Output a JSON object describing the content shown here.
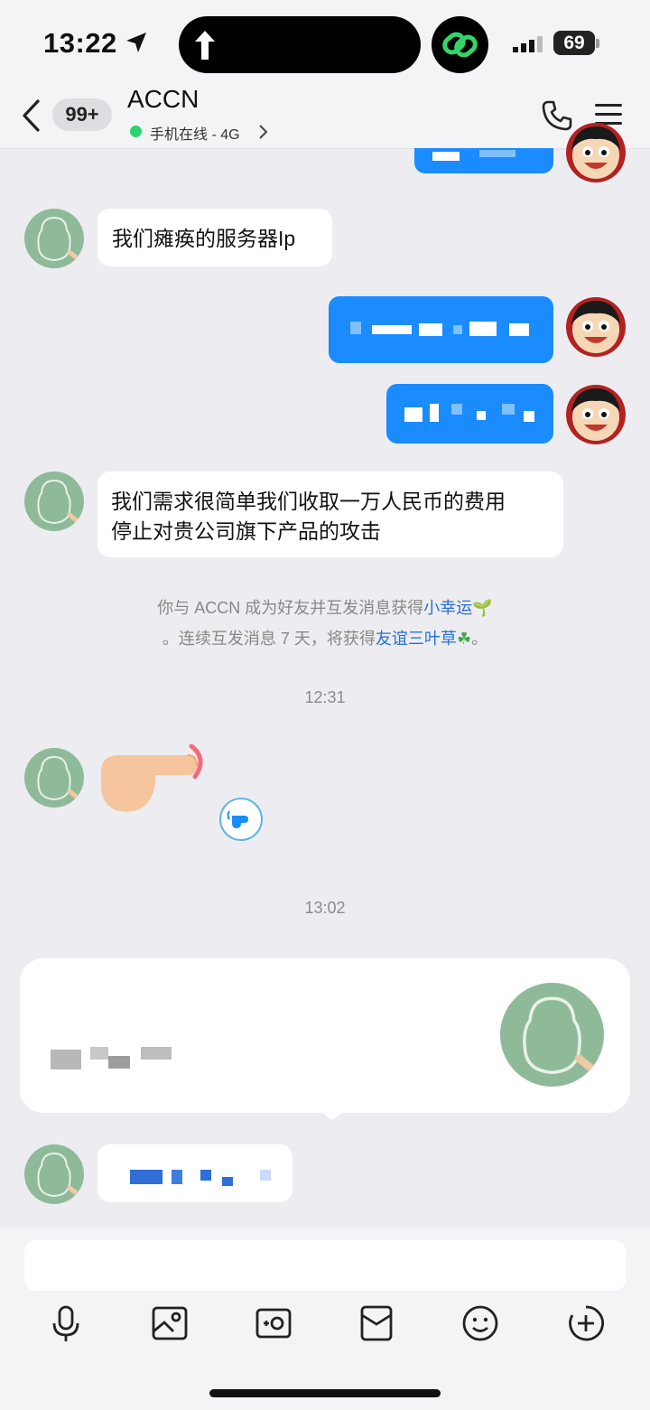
{
  "status_bar": {
    "time": "13:22",
    "battery": "69",
    "icons": [
      "location-arrow-icon",
      "upload-arrow-icon",
      "chain-link-icon",
      "signal-icon",
      "battery-icon"
    ]
  },
  "header": {
    "unread_badge": "99+",
    "contact_name": "ACCN",
    "online_status": "手机在线 - 4G"
  },
  "messages": {
    "friend_ip": "我们瘫痪的服务器Ip",
    "friend_demand_line1": "我们需求很简单我们收取一万人民币的费用",
    "friend_demand_line2": "停止对贵公司旗下产品的攻击"
  },
  "system_notice": {
    "line1_prefix": "你与 ACCN 成为好友并互发消息获得",
    "line1_link": "小幸运",
    "line1_emoji": "🌱",
    "line2_prefix": "。连续互发消息 7 天，将获得",
    "line2_link": "友谊三叶草",
    "line2_emoji": "☘",
    "line2_suffix": "。"
  },
  "timestamps": {
    "first": "12:31",
    "second": "13:02"
  },
  "colors": {
    "outgoing_bubble": "#1a8cff",
    "link": "#2a6fd6",
    "online_dot": "#2bd46e"
  },
  "toolbar_icons": [
    "microphone-icon",
    "image-icon",
    "camera-icon",
    "red-packet-icon",
    "emoji-icon",
    "plus-icon"
  ]
}
